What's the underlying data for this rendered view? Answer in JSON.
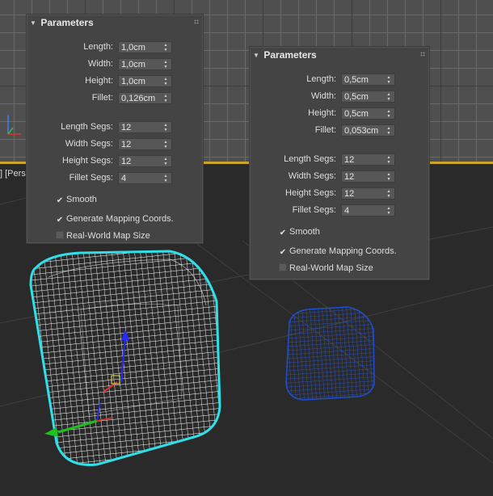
{
  "viewports": {
    "perspective_label": "] [Pers"
  },
  "panels": [
    {
      "title": "Parameters",
      "fields": [
        {
          "label": "Length:",
          "value": "1,0cm"
        },
        {
          "label": "Width:",
          "value": "1,0cm"
        },
        {
          "label": "Height:",
          "value": "1,0cm"
        },
        {
          "label": "Fillet:",
          "value": "0,126cm"
        }
      ],
      "segs": [
        {
          "label": "Length Segs:",
          "value": "12"
        },
        {
          "label": "Width Segs:",
          "value": "12"
        },
        {
          "label": "Height Segs:",
          "value": "12"
        },
        {
          "label": "Fillet Segs:",
          "value": "4"
        }
      ],
      "options": [
        {
          "label": "Smooth",
          "checked": true
        },
        {
          "label": "Generate Mapping Coords.",
          "checked": true
        },
        {
          "label": "Real-World Map Size",
          "checked": false
        }
      ]
    },
    {
      "title": "Parameters",
      "fields": [
        {
          "label": "Length:",
          "value": "0,5cm"
        },
        {
          "label": "Width:",
          "value": "0,5cm"
        },
        {
          "label": "Height:",
          "value": "0,5cm"
        },
        {
          "label": "Fillet:",
          "value": "0,053cm"
        }
      ],
      "segs": [
        {
          "label": "Length Segs:",
          "value": "12"
        },
        {
          "label": "Width Segs:",
          "value": "12"
        },
        {
          "label": "Height Segs:",
          "value": "12"
        },
        {
          "label": "Fillet Segs:",
          "value": "4"
        }
      ],
      "options": [
        {
          "label": "Smooth",
          "checked": true
        },
        {
          "label": "Generate Mapping Coords.",
          "checked": true
        },
        {
          "label": "Real-World Map Size",
          "checked": false
        }
      ]
    }
  ],
  "colors": {
    "selected_outline": "#30e0e8",
    "blue_wire": "#1f4fd0",
    "viewport_active_border": "#c8a52a"
  }
}
